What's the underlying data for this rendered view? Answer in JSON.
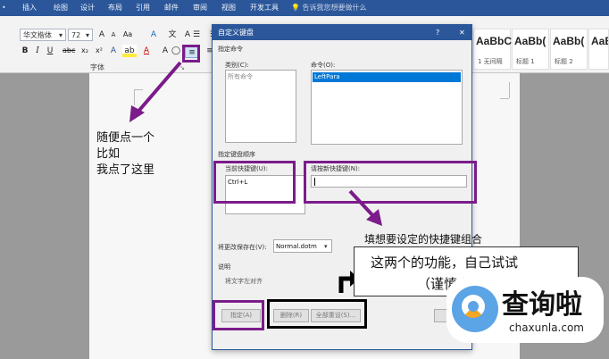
{
  "ribbon": {
    "tabs": [
      "插入",
      "绘图",
      "设计",
      "布局",
      "引用",
      "邮件",
      "审阅",
      "视图",
      "开发工具"
    ],
    "tell_me": "告诉我您想要做什么",
    "font_name": "华文楷体",
    "font_size": "72",
    "group_font": "字体",
    "styles": [
      {
        "sample": "AaBbC",
        "label": "1 无间隔"
      },
      {
        "sample": "AaBb(",
        "label": "标题 1"
      },
      {
        "sample": "AaBb(",
        "label": "标题 2"
      },
      {
        "sample": "AaBbC",
        "label": "标题"
      }
    ]
  },
  "annotations": {
    "click_note": [
      "随便点一个",
      "比如",
      "我点了这里"
    ],
    "fill_note": "填想要设定的快捷键组合",
    "func_note": [
      "这两个的功能，自己试试",
      "（谨慎点吧）"
    ]
  },
  "dialog": {
    "title": "自定义键盘",
    "help": "?",
    "close": "✕",
    "section_command": "指定命令",
    "categories_label": "类别(C):",
    "categories_item": "所有命令",
    "commands_label": "命令(O):",
    "commands_item": "LeftPara",
    "section_keys": "指定键盘顺序",
    "current_keys_label": "当前快捷键(U):",
    "current_keys_item": "Ctrl+L",
    "new_key_label": "请按新快捷键(N):",
    "save_in_label": "将更改保存在(V):",
    "save_in_value": "Normal.dotm",
    "description_label": "说明",
    "description_text": "将文字左对齐",
    "assign_button": "指定(A)",
    "remove_button": "删除(R)",
    "reset_button": "全部重设(S)..."
  },
  "watermark": {
    "brand": "查询啦",
    "url": "chaxunla.com"
  },
  "colors": {
    "accent_purple": "#7b1c8a",
    "ribbon_blue": "#2b579a",
    "selection_blue": "#0078d7"
  }
}
